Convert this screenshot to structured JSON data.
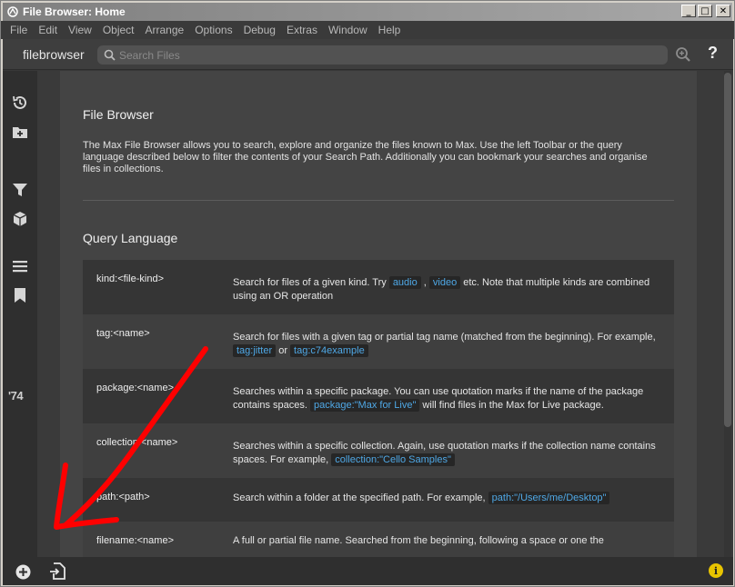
{
  "window": {
    "title": "File Browser: Home",
    "minimize": "_",
    "maximize": "□",
    "close": "✕"
  },
  "menubar": {
    "items": [
      "File",
      "Edit",
      "View",
      "Object",
      "Arrange",
      "Options",
      "Debug",
      "Extras",
      "Window",
      "Help"
    ]
  },
  "toolbar": {
    "brand": "filebrowser",
    "search_placeholder": "Search Files",
    "help_label": "?"
  },
  "sidebar": {
    "items": [
      {
        "icon": "history-icon"
      },
      {
        "icon": "add-folder-icon"
      },
      {
        "icon": "filter-icon"
      },
      {
        "icon": "package-icon"
      },
      {
        "icon": "list-icon"
      },
      {
        "icon": "bookmark-icon"
      }
    ],
    "max_logo_text": "'74"
  },
  "doc": {
    "title": "File Browser",
    "intro": "The Max File Browser allows you to search, explore and organize the files known to Max. Use the left Toolbar or the query language described below to filter the contents of your Search Path. Additionally you can bookmark your searches and organise files in collections.",
    "section_title": "Query Language",
    "rows": [
      {
        "key": "kind:<file-kind>",
        "pre": "Search for files of a given kind. Try ",
        "c1": "audio",
        "mid": " , ",
        "c2": "video",
        "post": " etc. Note that multiple kinds are combined using an OR operation"
      },
      {
        "key": "tag:<name>",
        "pre": "Search for files with a given tag or partial tag name (matched from the beginning). For example, ",
        "c1": "tag:jitter",
        "mid": " or ",
        "c2": "tag:c74example",
        "post": ""
      },
      {
        "key": "package:<name>",
        "pre": "Searches within a specific package. You can use quotation marks if the name of the package contains spaces. ",
        "c1": "package:\"Max for Live\"",
        "mid": " will find files in the Max for Live package.",
        "c2": "",
        "post": ""
      },
      {
        "key": "collection:<name>",
        "pre": "Searches within a specific collection. Again, use quotation marks if the collection name contains spaces. For example, ",
        "c1": "collection:\"Cello Samples\"",
        "mid": "",
        "c2": "",
        "post": ""
      },
      {
        "key": "path:<path>",
        "pre": "Search within a folder at the specified path. For example, ",
        "c1": "path:\"/Users/me/Desktop\"",
        "mid": "",
        "c2": "",
        "post": ""
      },
      {
        "key": "filename:<name>",
        "pre": "A full or partial file name. Searched from the beginning, following a space or one the",
        "c1": "",
        "mid": "",
        "c2": "",
        "post": ""
      }
    ]
  },
  "bottombar": {
    "info_label": "i"
  },
  "colors": {
    "accent_code": "#4fa8e6",
    "annotation": "#ff0000",
    "info_badge": "#e8c400"
  }
}
